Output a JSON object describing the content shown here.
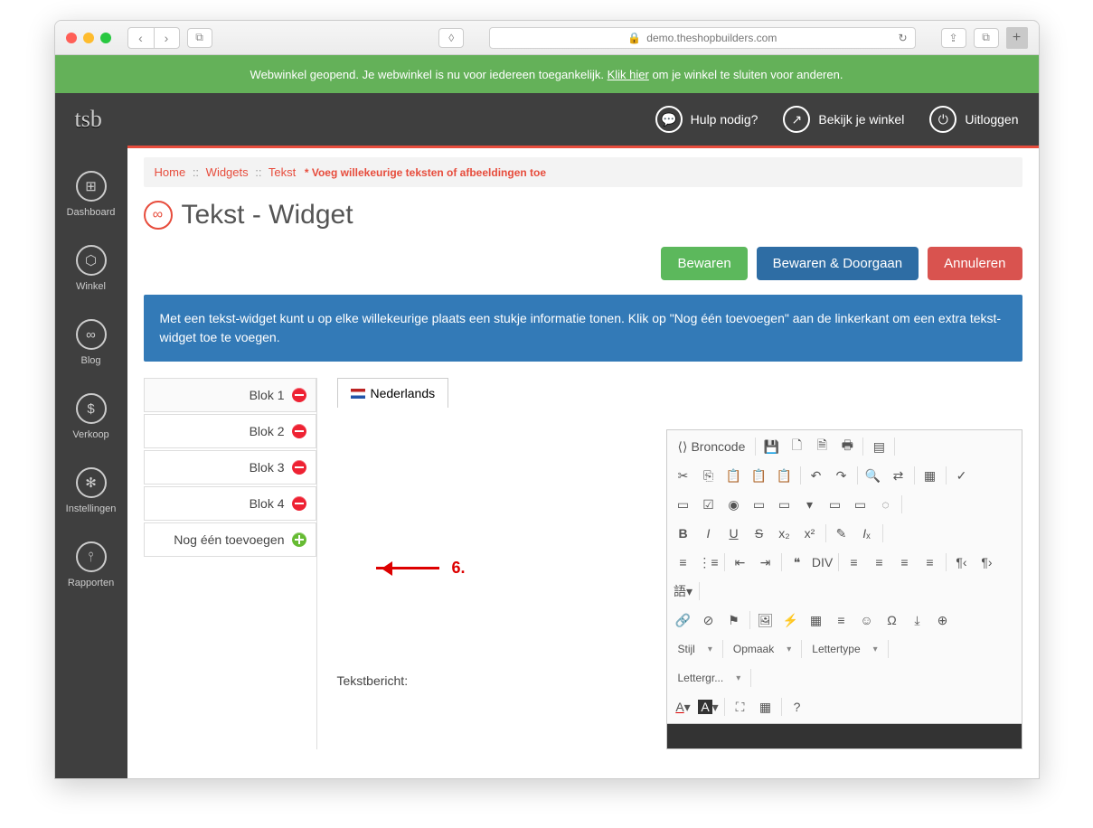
{
  "browser": {
    "url": "demo.theshopbuilders.com"
  },
  "banner": {
    "text_before": "Webwinkel geopend. Je webwinkel is nu voor iedereen toegankelijk. ",
    "link": "Klik hier",
    "text_after": " om je winkel te sluiten voor anderen."
  },
  "topbar": {
    "logo": "tsb",
    "help": "Hulp nodig?",
    "view": "Bekijk je winkel",
    "logout": "Uitloggen"
  },
  "rail": [
    "Dashboard",
    "Winkel",
    "Blog",
    "Verkoop",
    "Instellingen",
    "Rapporten"
  ],
  "crumbs": {
    "home": "Home",
    "widgets": "Widgets",
    "tekst": "Tekst",
    "note": "* Voeg willekeurige teksten of afbeeldingen toe"
  },
  "title": "Tekst - Widget",
  "buttons": {
    "save": "Bewaren",
    "cont": "Bewaren & Doorgaan",
    "cancel": "Annuleren"
  },
  "info": "Met een tekst-widget kunt u op elke willekeurige plaats een stukje informatie tonen. Klik op \"Nog één toevoegen\" aan de linkerkant om een extra tekst-widget toe te voegen.",
  "blocks": [
    "Blok 1",
    "Blok 2",
    "Blok 3",
    "Blok 4"
  ],
  "add_block": "Nog één toevoegen",
  "lang_tab": "Nederlands",
  "field_label": "Tekstbericht:",
  "editor_toolbar": {
    "source": "Broncode",
    "style": "Stijl",
    "format": "Opmaak",
    "font": "Lettertype",
    "size": "Lettergr..."
  },
  "annotation": "6."
}
